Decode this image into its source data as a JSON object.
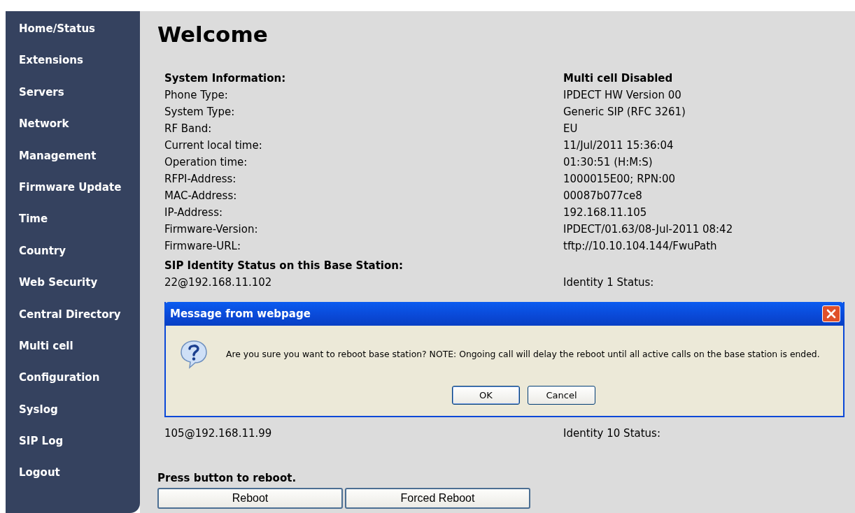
{
  "sidebar": {
    "items": [
      "Home/Status",
      "Extensions",
      "Servers",
      "Network",
      "Management",
      "Firmware Update",
      "Time",
      "Country",
      "Web Security",
      "Central Directory",
      "Multi cell",
      "Configuration",
      "Syslog",
      "SIP Log",
      "Logout"
    ]
  },
  "page": {
    "title": "Welcome"
  },
  "system_info": {
    "heading": "System Information:",
    "status": "Multi cell Disabled",
    "rows": [
      {
        "label": "Phone Type:",
        "value": "IPDECT HW Version 00"
      },
      {
        "label": "System Type:",
        "value": "Generic SIP (RFC 3261)"
      },
      {
        "label": "RF Band:",
        "value": "EU"
      },
      {
        "label": "Current local time:",
        "value": "11/Jul/2011 15:36:04"
      },
      {
        "label": "Operation time:",
        "value": "01:30:51 (H:M:S)"
      },
      {
        "label": "RFPI-Address:",
        "value": "1000015E00; RPN:00"
      },
      {
        "label": "MAC-Address:",
        "value": "00087b077ce8"
      },
      {
        "label": "IP-Address:",
        "value": "192.168.11.105"
      },
      {
        "label": "Firmware-Version:",
        "value": "IPDECT/01.63/08-Jul-2011 08:42"
      },
      {
        "label": "Firmware-URL:",
        "value": "tftp://10.10.104.144/FwuPath"
      }
    ]
  },
  "sip_identities": {
    "heading": "SIP Identity Status on this Base Station:",
    "rows_top": [
      {
        "identity": "22@192.168.11.102",
        "status": "Identity 1 Status:"
      }
    ],
    "rows_bottom": [
      {
        "identity": "105@192.168.11.99",
        "status": "Identity 10 Status:"
      }
    ]
  },
  "reboot": {
    "prompt": "Press button to reboot.",
    "buttons": [
      "Reboot",
      "Forced Reboot"
    ]
  },
  "dialog": {
    "title": "Message from webpage",
    "message": "Are you sure you want to reboot base station? NOTE: Ongoing call will delay the reboot until all active calls on the base station is ended.",
    "buttons": [
      "OK",
      "Cancel"
    ]
  }
}
